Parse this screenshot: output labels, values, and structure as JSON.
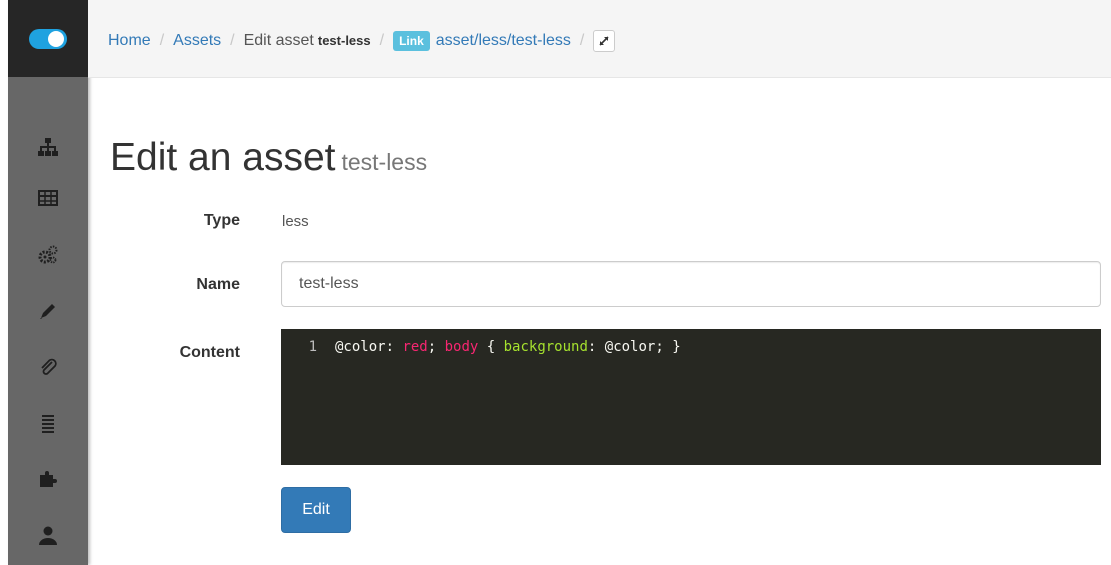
{
  "breadcrumb": {
    "home": "Home",
    "assets": "Assets",
    "edit_prefix": "Edit asset",
    "edit_name": "test-less",
    "link_badge": "Link",
    "link_path": "asset/less/test-less"
  },
  "title": {
    "main": "Edit an asset",
    "sub": "test-less"
  },
  "form": {
    "type_label": "Type",
    "type_value": "less",
    "name_label": "Name",
    "name_value": "test-less",
    "content_label": "Content",
    "editor": {
      "line_number": "1",
      "tok1": "@color: ",
      "tok2": "red",
      "tok3": "; ",
      "tok4": "body",
      "tok5": " { ",
      "tok6": "background",
      "tok7": ": @color; }"
    },
    "submit_label": "Edit"
  },
  "colors": {
    "sidebar": "#676767",
    "sidebar_top": "#262626",
    "logo": "#1fa2e0",
    "link": "#337ab7",
    "badge": "#5bc0de",
    "editor_bg": "#272822",
    "button": "#337ab7"
  },
  "sidebar_icons": [
    "sitemap-icon",
    "table-icon",
    "cogs-icon",
    "pencil-icon",
    "paperclip-icon",
    "list-icon",
    "puzzle-icon",
    "user-icon"
  ]
}
